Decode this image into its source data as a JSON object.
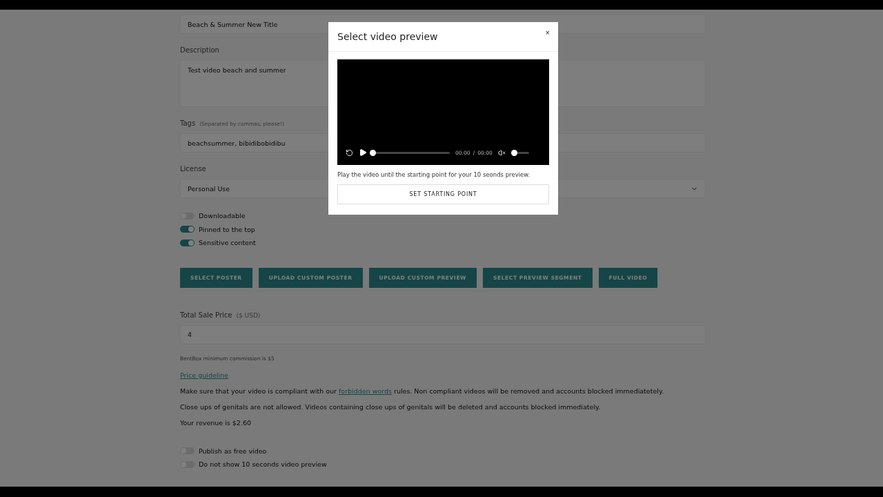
{
  "form": {
    "title_field": {
      "value": "Beach & Summer New Title"
    },
    "description": {
      "label": "Description",
      "value": "Test video beach and summer"
    },
    "tags": {
      "label": "Tags",
      "hint": "(Separated by commas, please!)",
      "value": "beachsummer, bibidibobidibu"
    },
    "license": {
      "label": "License",
      "value": "Personal Use"
    },
    "toggles": [
      {
        "label": "Downloadable",
        "on": false
      },
      {
        "label": "Pinned to the top",
        "on": true
      },
      {
        "label": "Sensitive content",
        "on": true
      }
    ],
    "buttons": [
      "SELECT POSTER",
      "UPLOAD CUSTOM POSTER",
      "UPLOAD CUSTOM PREVIEW",
      "SELECT PREVIEW SEGMENT",
      "FULL VIDEO"
    ],
    "price": {
      "label": "Total Sale Price",
      "unit": "($ USD)",
      "value": "4",
      "note": "BentBox minimum commission is $5"
    },
    "price_guideline": "Price guideline",
    "notices": [
      {
        "before": "Make sure that your video is compliant with our ",
        "link": "forbidden words",
        "after": " rules. Non compliant videos will be removed and accounts blocked immediatetely."
      },
      {
        "before": "Close ups of genitals are not allowed. Videos containing close ups of genitals will be deleted and accounts blocked immediately."
      },
      {
        "before": "Your revenue is $2.60"
      }
    ],
    "bottom_toggles": [
      {
        "label": "Publish as free video",
        "on": false
      },
      {
        "label": "Do not show 10 seconds video preview",
        "on": false
      }
    ]
  },
  "modal": {
    "title": "Select video preview",
    "close": "×",
    "player": {
      "progress": {
        "level": 0
      },
      "current_time": "00:00",
      "separator": "/",
      "duration": "00:00",
      "muted": true,
      "volume": {
        "level": 0
      }
    },
    "instruction": "Play the video until the starting point for your 10 seonds preview.",
    "button": "SET STARTING POINT"
  }
}
